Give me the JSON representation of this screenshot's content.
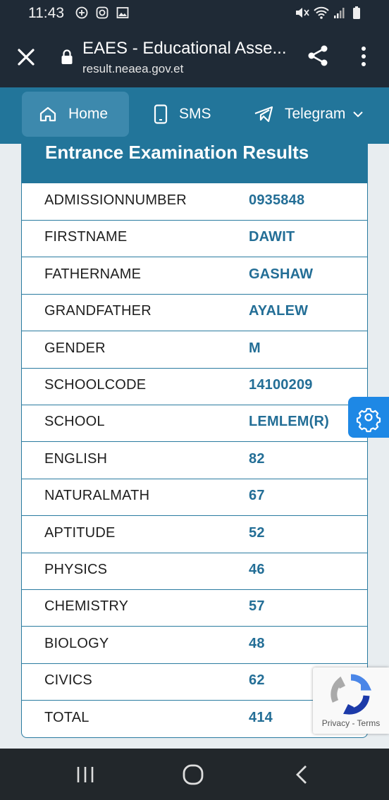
{
  "status_bar": {
    "time": "11:43"
  },
  "browser": {
    "title": "EAES - Educational Asse...",
    "url": "result.neaea.gov.et"
  },
  "nav": {
    "items": [
      {
        "label": "Home",
        "icon": "home-icon"
      },
      {
        "label": "SMS",
        "icon": "phone-icon"
      },
      {
        "label": "Telegram",
        "icon": "telegram-icon"
      }
    ]
  },
  "results": {
    "title": "Entrance Examination Results",
    "rows": [
      {
        "label": "ADMISSIONNUMBER",
        "value": "0935848"
      },
      {
        "label": "FIRSTNAME",
        "value": "DAWIT"
      },
      {
        "label": "FATHERNAME",
        "value": "GASHAW"
      },
      {
        "label": "GRANDFATHER",
        "value": "AYALEW"
      },
      {
        "label": "GENDER",
        "value": "M"
      },
      {
        "label": "SCHOOLCODE",
        "value": "14100209"
      },
      {
        "label": "SCHOOL",
        "value": "LEMLEM(R)"
      },
      {
        "label": "ENGLISH",
        "value": "82"
      },
      {
        "label": "NATURALMATH",
        "value": "67"
      },
      {
        "label": "APTITUDE",
        "value": "52"
      },
      {
        "label": "PHYSICS",
        "value": "46"
      },
      {
        "label": "CHEMISTRY",
        "value": "57"
      },
      {
        "label": "BIOLOGY",
        "value": "48"
      },
      {
        "label": "CIVICS",
        "value": "62"
      },
      {
        "label": "TOTAL",
        "value": "414"
      }
    ]
  },
  "recaptcha": {
    "links": "Privacy - Terms"
  },
  "colors": {
    "primary": "#22759a",
    "value_text": "#236e96",
    "top_bar": "#1f2a36",
    "fab": "#1e88e5"
  }
}
